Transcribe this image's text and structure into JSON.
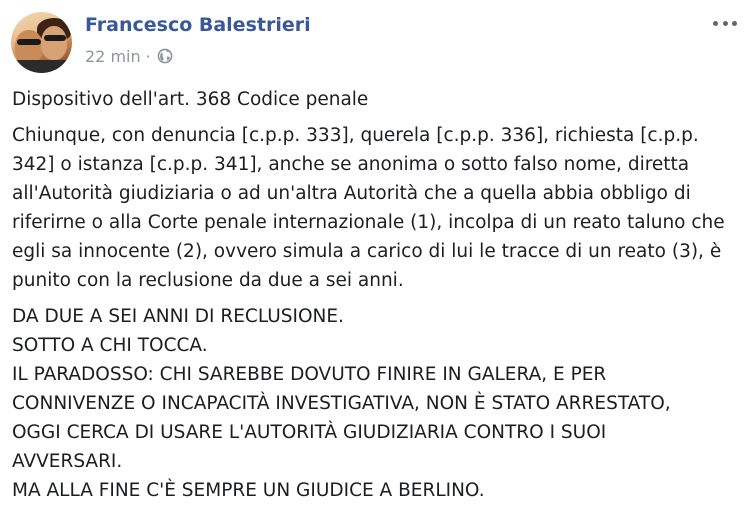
{
  "post": {
    "author": "Francesco Balestrieri",
    "time": "22 min",
    "separator": "·",
    "audience_icon": "globe-icon",
    "more_icon": "more-options-icon",
    "paragraphs": {
      "title": "Dispositivo dell'art. 368 Codice penale",
      "article": "Chiunque, con denuncia [c.p.p. 333], querela [c.p.p. 336], richiesta [c.p.p. 342] o istanza [c.p.p. 341], anche se anonima o sotto falso nome, diretta all'Autorità giudiziaria o ad un'altra Autorità che a quella abbia obbligo di riferirne o alla Corte penale internazionale (1), incolpa di un reato taluno che egli sa innocente (2), ovvero simula a carico di lui le tracce di un reato (3), è punito con la reclusione da due a sei anni.",
      "caps_lines": [
        "DA DUE A SEI ANNI DI RECLUSIONE.",
        "SOTTO A CHI TOCCA.",
        "IL PARADOSSO: CHI SAREBBE DOVUTO FINIRE IN GALERA, E PER",
        "CONNIVENZE O INCAPACITÀ INVESTIGATIVA, NON È STATO ARRESTATO,",
        "OGGI CERCA DI USARE L'AUTORITÀ GIUDIZIARIA CONTRO I SUOI",
        "AVVERSARI.",
        "MA ALLA FINE C'È SEMPRE UN GIUDICE A BERLINO."
      ]
    }
  },
  "colors": {
    "author": "#385898",
    "meta": "#8d949e",
    "text": "#1c1e21"
  }
}
